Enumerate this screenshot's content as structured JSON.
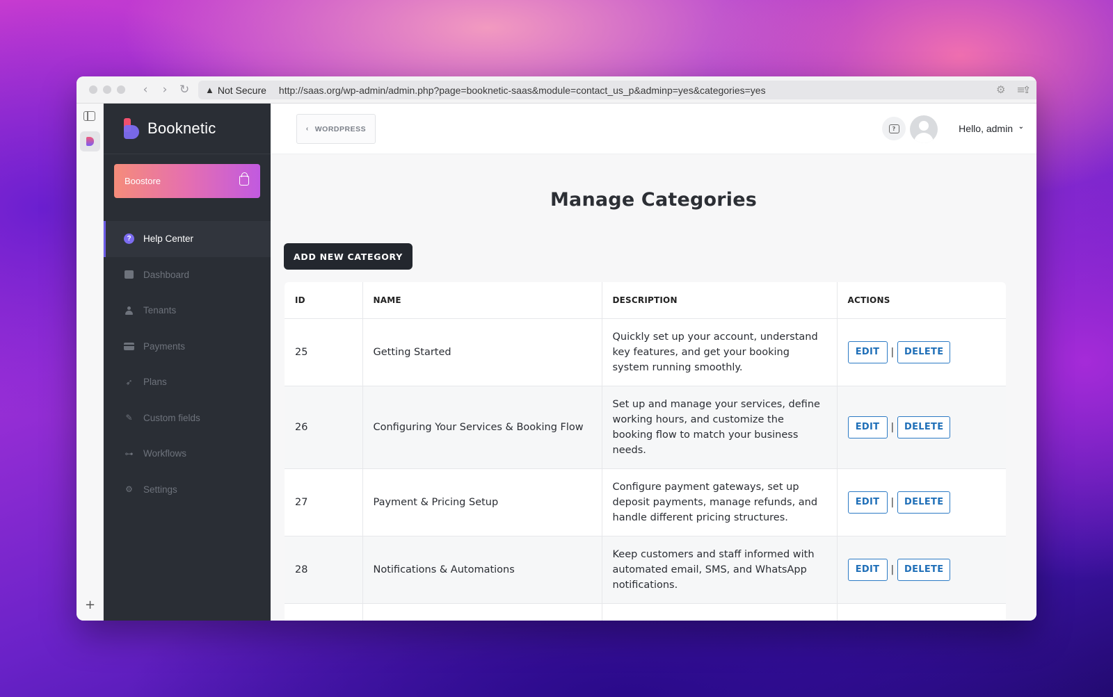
{
  "browser": {
    "security_label": "Not Secure",
    "url": "http://saas.org/wp-admin/admin.php?page=booknetic-saas&module=contact_us_p&adminp=yes&categories=yes"
  },
  "sidebar": {
    "brand": "Booknetic",
    "boostore": "Boostore",
    "items": [
      {
        "label": "Help Center",
        "icon": "help-circle-icon",
        "active": true
      },
      {
        "label": "Dashboard",
        "icon": "box-icon"
      },
      {
        "label": "Tenants",
        "icon": "user-icon"
      },
      {
        "label": "Payments",
        "icon": "credit-card-icon"
      },
      {
        "label": "Plans",
        "icon": "rocket-icon"
      },
      {
        "label": "Custom fields",
        "icon": "magic-wand-icon"
      },
      {
        "label": "Workflows",
        "icon": "workflow-icon"
      },
      {
        "label": "Settings",
        "icon": "gear-icon"
      }
    ]
  },
  "topbar": {
    "back_label": "WORDPRESS",
    "greeting": "Hello, admin"
  },
  "page": {
    "title": "Manage Categories",
    "add_button": "ADD NEW CATEGORY"
  },
  "table": {
    "headers": [
      "ID",
      "NAME",
      "DESCRIPTION",
      "ACTIONS"
    ],
    "edit_label": "EDIT",
    "delete_label": "DELETE",
    "separator": "|",
    "rows": [
      {
        "id": "25",
        "name": "Getting Started",
        "description": "Quickly set up your account, understand key features, and get your booking system running smoothly."
      },
      {
        "id": "26",
        "name": "Configuring Your Services & Booking Flow",
        "description": "Set up and manage your services, define working hours, and customize the booking flow to match your business needs."
      },
      {
        "id": "27",
        "name": "Payment & Pricing Setup",
        "description": "Configure payment gateways, set up deposit payments, manage refunds, and handle different pricing structures."
      },
      {
        "id": "28",
        "name": "Notifications & Automations",
        "description": "Keep customers and staff informed with automated email, SMS, and WhatsApp notifications."
      }
    ]
  },
  "colors": {
    "sidebar_bg": "#2a2e35",
    "accent": "#6c5ce7",
    "action_blue": "#1f6fb8"
  }
}
